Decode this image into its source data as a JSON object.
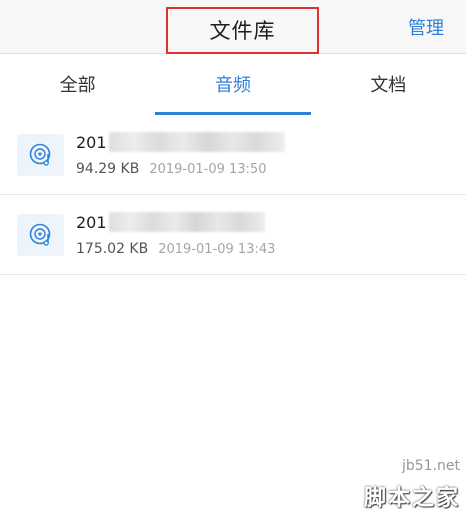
{
  "header": {
    "title": "文件库",
    "manage_label": "管理"
  },
  "tabs": [
    {
      "label": "全部",
      "active": false
    },
    {
      "label": "音频",
      "active": true
    },
    {
      "label": "文档",
      "active": false
    }
  ],
  "files": [
    {
      "name_prefix": "201",
      "size": "94.29 KB",
      "date": "2019-01-09 13:50",
      "icon": "audio-file-icon"
    },
    {
      "name_prefix": "201",
      "size": "175.02 KB",
      "date": "2019-01-09 13:43",
      "icon": "audio-file-icon"
    }
  ],
  "watermark": {
    "url": "jb51.net",
    "name": "脚本之家"
  },
  "colors": {
    "accent": "#2f80d8",
    "highlight_box": "#e0302f",
    "icon_background": "#eef4fb"
  }
}
